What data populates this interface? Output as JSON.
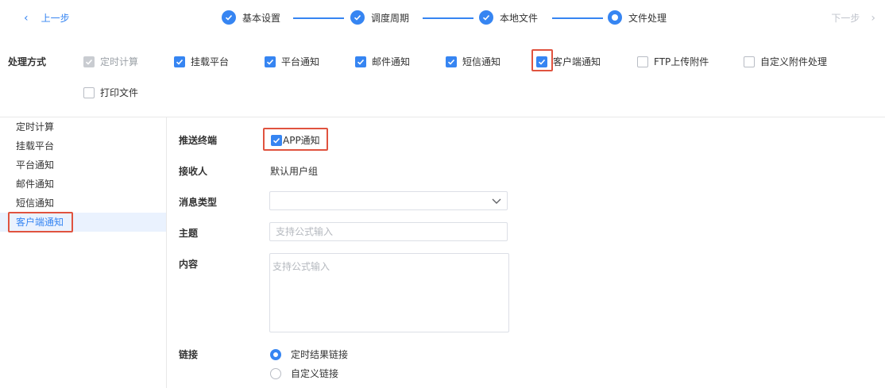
{
  "nav": {
    "prev_label": "上一步",
    "next_label": "下一步"
  },
  "steps": [
    {
      "label": "基本设置",
      "state": "done"
    },
    {
      "label": "调度周期",
      "state": "done"
    },
    {
      "label": "本地文件",
      "state": "done"
    },
    {
      "label": "文件处理",
      "state": "current"
    }
  ],
  "methods": {
    "label": "处理方式",
    "options": [
      {
        "label": "定时计算",
        "checked": true,
        "disabled": true
      },
      {
        "label": "挂载平台",
        "checked": true
      },
      {
        "label": "平台通知",
        "checked": true
      },
      {
        "label": "邮件通知",
        "checked": true
      },
      {
        "label": "短信通知",
        "checked": true
      },
      {
        "label": "客户端通知",
        "checked": true
      },
      {
        "label": "FTP上传附件",
        "checked": false
      },
      {
        "label": "自定义附件处理",
        "checked": false
      },
      {
        "label": "打印文件",
        "checked": false
      }
    ]
  },
  "sidebar": {
    "items": [
      {
        "label": "定时计算"
      },
      {
        "label": "挂载平台"
      },
      {
        "label": "平台通知"
      },
      {
        "label": "邮件通知"
      },
      {
        "label": "短信通知"
      },
      {
        "label": "客户端通知",
        "active": true
      }
    ]
  },
  "form": {
    "push_terminal": {
      "label": "推送终端",
      "option_label": "APP通知",
      "checked": true
    },
    "receiver": {
      "label": "接收人",
      "value": "默认用户组"
    },
    "message_type": {
      "label": "消息类型",
      "value": ""
    },
    "subject": {
      "label": "主题",
      "placeholder": "支持公式输入"
    },
    "content": {
      "label": "内容",
      "placeholder": "支持公式输入"
    },
    "link": {
      "label": "链接",
      "options": [
        {
          "label": "定时结果链接",
          "selected": true
        },
        {
          "label": "自定义链接",
          "selected": false
        }
      ]
    }
  },
  "colors": {
    "accent": "#3685f2",
    "highlight": "#e0533f",
    "active_bg": "#eaf2fe"
  }
}
